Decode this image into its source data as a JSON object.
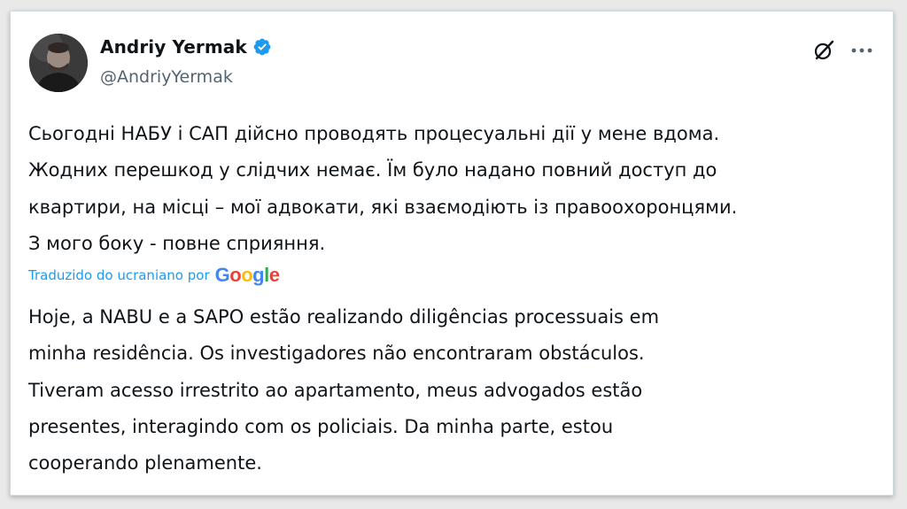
{
  "author": {
    "display_name": "Andriy Yermak",
    "handle": "@AndriyYermak",
    "verified": true,
    "verified_color": "#1d9bf0",
    "avatar_icon": "profile-photo"
  },
  "actions": {
    "grok_icon": "grok-icon",
    "more_icon": "more-horizontal-icon",
    "more_label": "···"
  },
  "tweet": {
    "original_text": "Сьогодні НАБУ і САП дійсно проводять процесуальні дії у мене вдома.\nЖодних перешкод у слідчих немає. Їм було надано повний доступ до\nквартири, на місці – мої адвокати, які взаємодіють із правоохоронцями.\nЗ мого боку - повне сприяння.",
    "translation_label": "Traduzido do ucraniano por",
    "translation_provider": "Google",
    "translated_text": "Hoje, a NABU e a SAPO estão realizando diligências processuais em\nminha residência. Os investigadores não encontraram obstáculos.\nTiveram acesso irrestrito ao apartamento, meus advogados estão\npresentes, interagindo com os policiais. Da minha parte, estou\ncooperando plenamente."
  },
  "colors": {
    "text": "#0f1419",
    "secondary": "#536471",
    "link": "#1d9bf0",
    "border": "#cfd9de",
    "background": "#ffffff"
  }
}
